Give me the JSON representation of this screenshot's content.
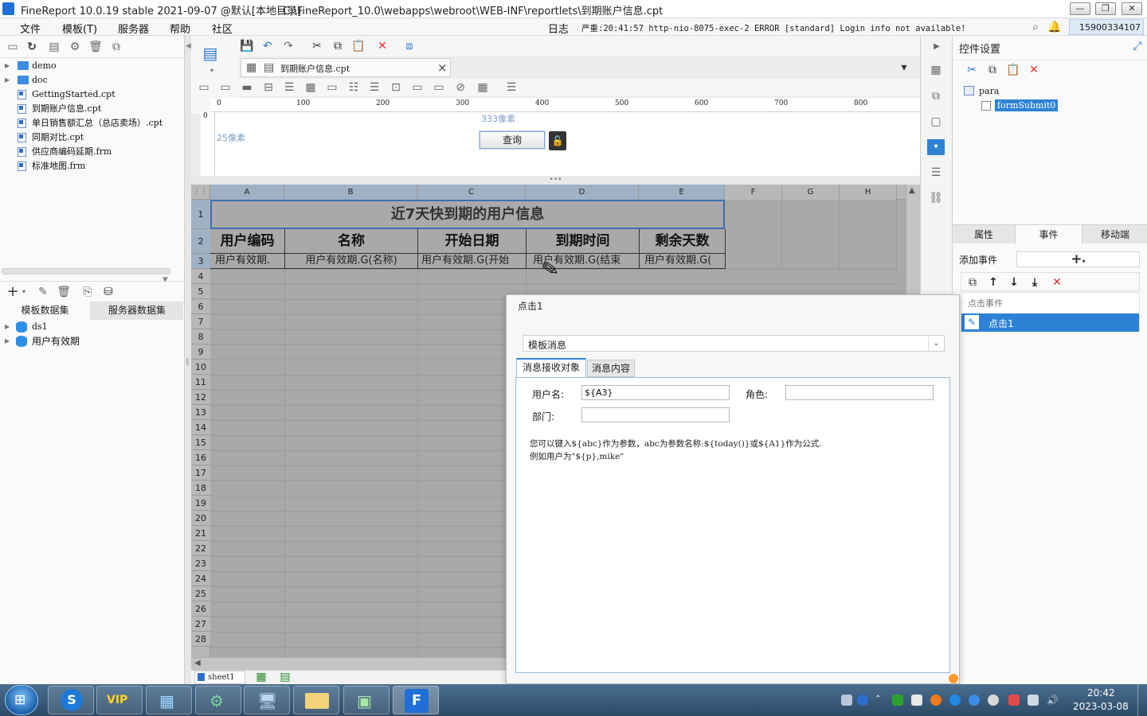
{
  "window": {
    "app_title": "FineReport 10.0.19 stable 2021-09-07 @默认[本地目录]",
    "file_path": "C:\\FineReport_10.0\\webapps\\webroot\\WEB-INF\\reportlets\\到期账户信息.cpt",
    "min_icon": "—",
    "max_icon": "❐",
    "close_icon": "✕"
  },
  "menubar": {
    "items": [
      "文件",
      "模板(T)",
      "服务器",
      "帮助",
      "社区"
    ],
    "log_label": "日志",
    "log_message": "严重:20:41:57 http-nio-8075-exec-2 ERROR [standard] Login info not available!",
    "user": "15900334107"
  },
  "file_tree": {
    "items": [
      {
        "label": "demo",
        "type": "folder"
      },
      {
        "label": "doc",
        "type": "folder"
      },
      {
        "label": "GettingStarted.cpt",
        "type": "file"
      },
      {
        "label": "到期账户信息.cpt",
        "type": "file"
      },
      {
        "label": "单日销售额汇总（总店卖场）.cpt",
        "type": "file"
      },
      {
        "label": "同期对比.cpt",
        "type": "file"
      },
      {
        "label": "供应商编码延期.frm",
        "type": "file"
      },
      {
        "label": "标准地图.frm",
        "type": "file"
      }
    ]
  },
  "dataset_tabs": {
    "template": "模板数据集",
    "server": "服务器数据集",
    "items": [
      "ds1",
      "用户有效期"
    ]
  },
  "editor": {
    "tab_label": "到期账户信息.cpt",
    "tab_close": "×",
    "ruler_ticks": [
      "0",
      "100",
      "200",
      "300",
      "400",
      "500",
      "600",
      "700",
      "800"
    ],
    "ruler_v_tick": "0",
    "width_hint": "333像素",
    "height_hint": "25像素",
    "query_button": "查询",
    "lock_icon": "🔓"
  },
  "sheet": {
    "columns": [
      "A",
      "B",
      "C",
      "D",
      "E",
      "F",
      "G",
      "H"
    ],
    "rows": [
      "1",
      "2",
      "3",
      "4",
      "5",
      "6",
      "7",
      "8",
      "9",
      "10",
      "11",
      "12",
      "13",
      "14",
      "15",
      "16",
      "17",
      "18",
      "19",
      "20",
      "21",
      "22",
      "23",
      "24",
      "25",
      "26",
      "27",
      "28"
    ],
    "title": "近7天快到期的用户信息",
    "headers": [
      "用户编码",
      "名称",
      "开始日期",
      "到期时间",
      "剩余天数"
    ],
    "data_row": [
      "用户有效期.",
      "用户有效期.G(名称)",
      "用户有效期.G(开始",
      "用户有效期.G(结束",
      "用户有效期.G("
    ],
    "sheet_tab": "sheet1"
  },
  "dialog": {
    "title": "点击1",
    "dropdown_value": "模板消息",
    "tabs": [
      "消息接收对象",
      "消息内容"
    ],
    "fields": {
      "username_label": "用户名:",
      "username_value": "${A3}",
      "role_label": "角色:",
      "role_value": "",
      "dept_label": "部门:",
      "dept_value": ""
    },
    "hint_line1": "您可以键入${abc}作为参数，abc为参数名称:${today()}或${A1}作为公式.",
    "hint_line2": "例如用户为\"${p},mike\""
  },
  "right_panel": {
    "title": "控件设置",
    "tree_root": "para",
    "tree_child": "formSubmit0",
    "tabs": [
      "属性",
      "事件",
      "移动端"
    ],
    "add_event_label": "添加事件",
    "add_event_btn": "+",
    "event_section": "点击事件",
    "event_item": "点击1"
  },
  "taskbar": {
    "time": "20:42",
    "date": "2023-03-08"
  }
}
